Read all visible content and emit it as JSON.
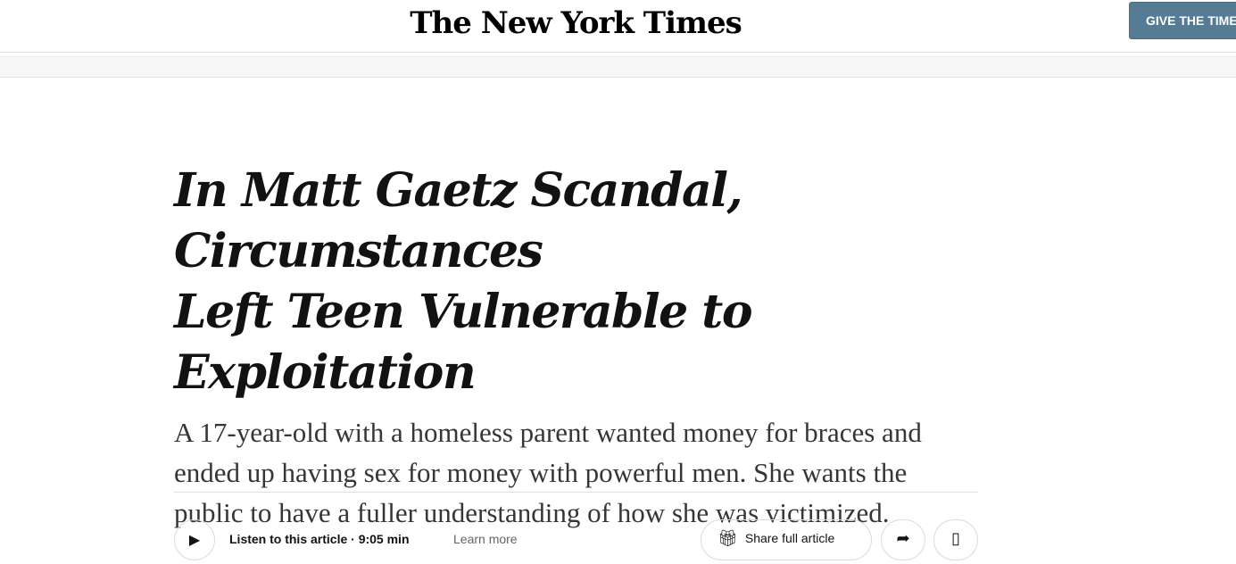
{
  "header": {
    "logo_text": "The New York Times",
    "give_button_label": "GIVE THE TIMES"
  },
  "article": {
    "headline_line1": "In Matt Gaetz Scandal, Circumstances",
    "headline_line2": "Left Teen Vulnerable to Exploitation",
    "summary": "A 17-year-old with a homeless parent wanted money for braces and ended up having sex for money with powerful men. She wants the public to have a fuller understanding of how she was victimized."
  },
  "toolbar": {
    "listen_label": "Listen to this article · 9:05 min",
    "learn_more": "Learn more",
    "share_full_label": "Share full article",
    "icons": [
      "play-icon",
      "gift-icon",
      "share-icon",
      "bookmark-icon"
    ]
  }
}
